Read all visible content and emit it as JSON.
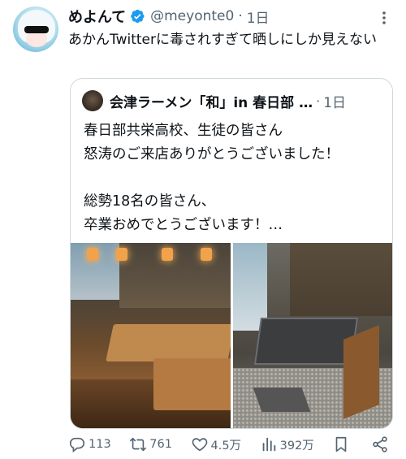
{
  "tweet": {
    "display_name": "めよんて",
    "handle": "@meyonte0",
    "separator": "·",
    "time": "1日",
    "text": "あかんTwitterに毒されすぎて晒しにしか見えない",
    "verified_color": "#1d9bf0"
  },
  "quote": {
    "display_name": "会津ラーメン「和」in 春日部 …",
    "separator": "·",
    "time": "1日",
    "text": "春日部共栄高校、生徒の皆さん\n怒涛のご来店ありがとうございました！\n\n総勢18名の皆さん、\n卒業おめでとうございます！…"
  },
  "actions": {
    "replies": "113",
    "retweets": "761",
    "likes": "4.5万",
    "views": "392万"
  },
  "icons": [
    "verified-icon",
    "more-icon",
    "reply-icon",
    "retweet-icon",
    "like-icon",
    "views-icon",
    "bookmark-icon",
    "share-icon"
  ]
}
